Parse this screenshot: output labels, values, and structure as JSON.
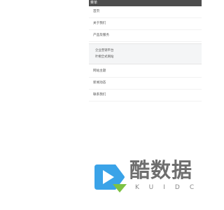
{
  "menu": {
    "header": "菜单",
    "items": [
      {
        "label": "首页"
      },
      {
        "label": "关于我们"
      },
      {
        "label": "产品及服务"
      },
      {
        "label": "网站主题"
      },
      {
        "label": "新闻动态"
      },
      {
        "label": "联系我们"
      }
    ],
    "submenu": [
      {
        "label": "企业营销平台"
      },
      {
        "label": "叶桐全式网站"
      }
    ]
  },
  "watermark": {
    "text_cn": "酷数据",
    "text_en": "KUIDC",
    "icon": "kuidc-logo-icon",
    "colors": {
      "blue": "#3aa3e8",
      "green": "#7dc243",
      "gray": "#6e6e6e"
    }
  }
}
